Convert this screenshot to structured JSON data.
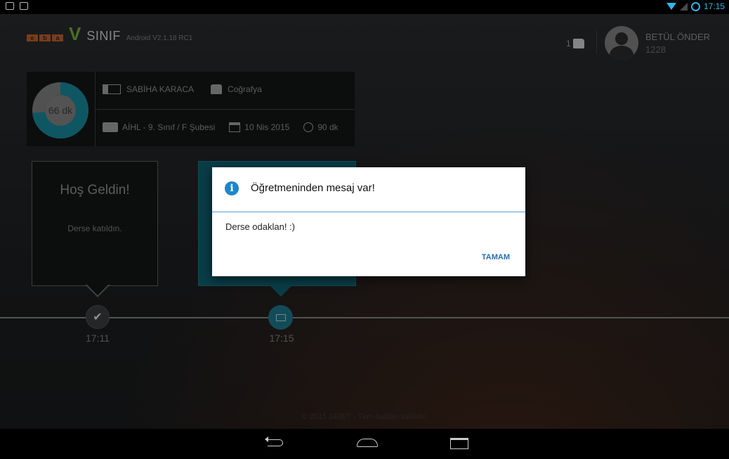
{
  "status_bar": {
    "time": "17:15"
  },
  "header": {
    "brand": "SINIF",
    "version": "Android V2.1.18 RC1"
  },
  "user": {
    "likes": "1",
    "name": "BETÜL ÖNDER",
    "id": "1228"
  },
  "lesson": {
    "remaining": "66 dk",
    "remaining_fraction": 0.733,
    "teacher": "SABİHA KARACA",
    "subject": "Coğrafya",
    "class_name": "AİHL -  9. Sınıf / F Şubesi",
    "date": "10 Nis 2015",
    "duration": "90 dk"
  },
  "timeline": {
    "welcome_title": "Hoş Geldin!",
    "welcome_text": "Derse katıldın.",
    "event1_time": "17:11",
    "event2_time": "17:15"
  },
  "footer": {
    "copyright": "© 2015 SEBİT - Tüm hakları saklıdır."
  },
  "dialog": {
    "title": "Öğretmeninden mesaj var!",
    "message": "Derse odaklan! :)",
    "ok_label": "TAMAM"
  },
  "colors": {
    "accent": "#1f7f93",
    "dialog_icon": "#1e86c7",
    "donut_track": "#888888",
    "donut_fill": "#1a8fa6"
  }
}
